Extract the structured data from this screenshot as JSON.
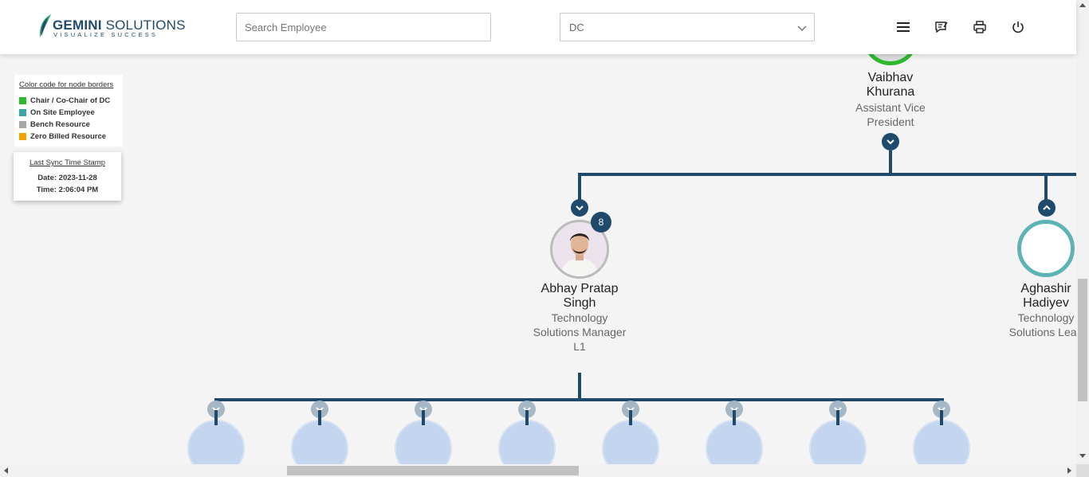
{
  "header": {
    "logo": {
      "name_bold": "GEMINI",
      "name_regular": " SOLUTIONS",
      "tagline": "VISUALIZE SUCCESS"
    },
    "search": {
      "placeholder": "Search Employee"
    },
    "department_select": {
      "value": "DC"
    },
    "icons": [
      "menu-icon",
      "feedback-icon",
      "print-icon",
      "power-icon"
    ]
  },
  "legend": {
    "title": "Color code for node borders",
    "items": [
      {
        "label": "Chair / Co-Chair of DC",
        "color": "#2eb82e"
      },
      {
        "label": "On Site Employee",
        "color": "#3aa6a6"
      },
      {
        "label": "Bench Resource",
        "color": "#a6a6a6"
      },
      {
        "label": "Zero Billed Resource",
        "color": "#f0a500"
      }
    ]
  },
  "sync": {
    "title": "Last Sync Time Stamp",
    "date": "Date: 2023-11-28",
    "time": "Time: 2:06:04 PM"
  },
  "tree": {
    "root": {
      "name": "Vaibhav Khurana",
      "title": "Assistant Vice President",
      "border_color": "#2eb82e"
    },
    "children": [
      {
        "name": "Abhay Pratap Singh",
        "title": "Technology Solutions Manager L1",
        "count": "8"
      },
      {
        "name": "Aghashir Hadiyev",
        "title": "Technology Solutions Lead",
        "border_color": "#5fb3b3"
      }
    ],
    "line_color": "#1f4a6b"
  }
}
